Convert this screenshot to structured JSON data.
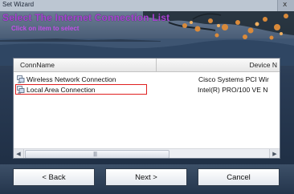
{
  "window": {
    "title": "Set Wizard",
    "close_label": "x"
  },
  "banner": {
    "title": "Select The Internet Connection List",
    "subtitle": "Click on item to select"
  },
  "list": {
    "columns": [
      "ConnName",
      "Device N"
    ],
    "rows": [
      {
        "name": "Wireless Network Connection",
        "device": "Cisco Systems PCI Wir",
        "icon": "network-connection-icon"
      },
      {
        "name": "Local Area Connection",
        "device": "Intel(R) PRO/100 VE N",
        "icon": "network-connection-icon",
        "highlighted": true
      }
    ],
    "scroll_grip": "||||"
  },
  "buttons": {
    "back": "< Back",
    "next": "Next >",
    "cancel": "Cancel"
  },
  "colors": {
    "banner_title": "#a743d2",
    "banner_subtitle": "#c24ee6",
    "highlight_border": "#e02020"
  }
}
